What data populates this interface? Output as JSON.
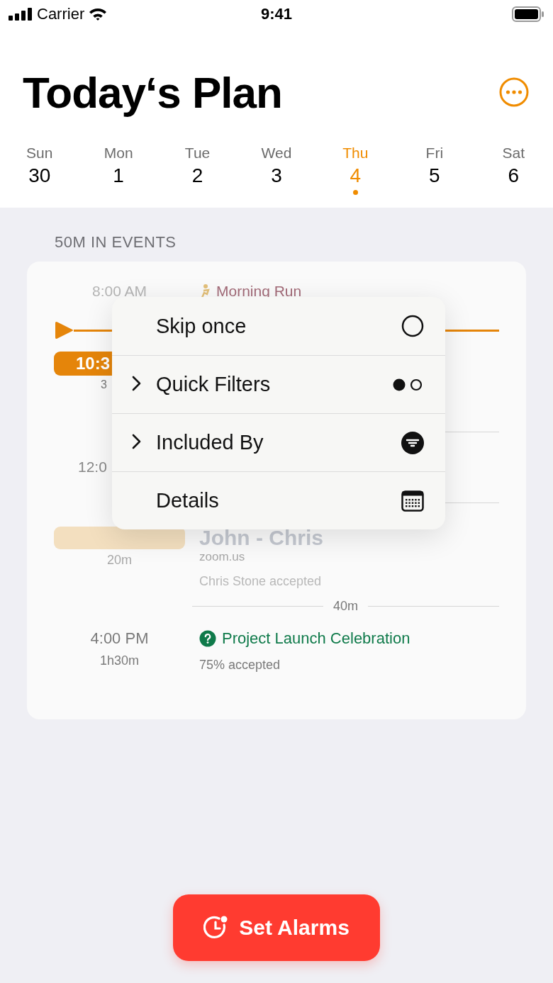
{
  "status_bar": {
    "carrier": "Carrier",
    "time": "9:41"
  },
  "title": "Today‘s Plan",
  "week": [
    {
      "day": "Sun",
      "date": "30",
      "selected": false
    },
    {
      "day": "Mon",
      "date": "1",
      "selected": false
    },
    {
      "day": "Tue",
      "date": "2",
      "selected": false
    },
    {
      "day": "Wed",
      "date": "3",
      "selected": false
    },
    {
      "day": "Thu",
      "date": "4",
      "selected": true
    },
    {
      "day": "Fri",
      "date": "5",
      "selected": false
    },
    {
      "day": "Sat",
      "date": "6",
      "selected": false
    }
  ],
  "summary": "50M IN EVENTS",
  "morning_event": {
    "time": "8:00 AM",
    "title": "Morning Run"
  },
  "now_marker": {
    "time": "10:3",
    "note": "3"
  },
  "hidden_event": {
    "time": "12:0"
  },
  "meeting": {
    "duration": "20m",
    "title": "John - Chris",
    "location": "zoom.us",
    "status": "Chris Stone accepted"
  },
  "gap": "40m",
  "celebration": {
    "time": "4:00 PM",
    "duration": "1h30m",
    "title": "Project Launch Celebration",
    "status": "75% accepted"
  },
  "menu": [
    {
      "label": "Skip once",
      "submenu": false,
      "kind": "circle"
    },
    {
      "label": "Quick Filters",
      "submenu": true,
      "kind": "dots"
    },
    {
      "label": "Included By",
      "submenu": true,
      "kind": "filter"
    },
    {
      "label": "Details",
      "submenu": false,
      "kind": "calendar"
    }
  ],
  "action_button": {
    "label": "Set Alarms"
  }
}
